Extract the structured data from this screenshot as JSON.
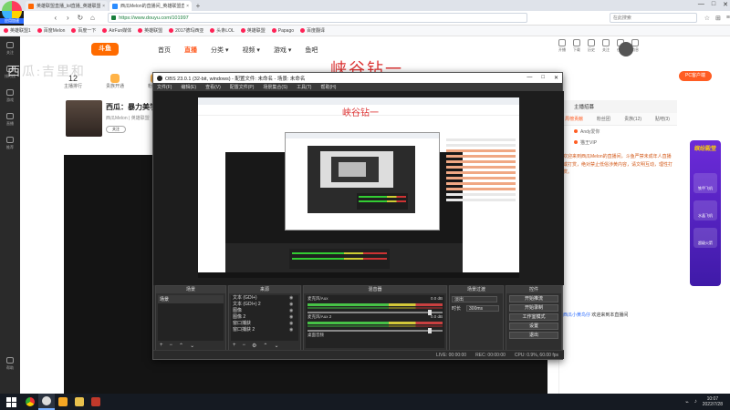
{
  "browser": {
    "corner_brand": "",
    "corner_badge": "应用加速",
    "tabs": [
      {
        "title": "英雄联盟直播_lol直播_英雄联盟...",
        "active": false
      },
      {
        "title": "西瓜Melon的直播间_英雄联盟直播...",
        "active": true
      }
    ],
    "new_tab": "+",
    "url": "https://www.douyu.com/101997",
    "search_placeholder": "在此搜索",
    "bookmarks": [
      "英雄联盟1",
      "百度Melon",
      "百度一下",
      "AirFun媒体",
      "英雄联盟",
      "2017德玛西亚",
      "头条LOL",
      "英雄联盟",
      "Papago",
      "百度翻译"
    ],
    "window_controls": [
      "—",
      "□",
      "✕"
    ]
  },
  "douyu": {
    "logo": "斗鱼",
    "nav": [
      {
        "label": "首页",
        "active": false
      },
      {
        "label": "直播",
        "active": true
      },
      {
        "label": "分类 ▾",
        "active": false
      },
      {
        "label": "视频 ▾",
        "active": false
      },
      {
        "label": "游戏 ▾",
        "active": false
      },
      {
        "label": "鱼吧",
        "active": false
      }
    ],
    "header_icons": [
      "开播",
      "下载",
      "历史",
      "关注",
      "任务",
      "消息"
    ],
    "pc_button": "PC客户端",
    "watermark_left": "西瓜:吉里和",
    "watermark_red": "峡谷钻一",
    "stats": [
      {
        "value": "12",
        "label": "主播排行"
      },
      {
        "value": "",
        "label": "贵族开通"
      },
      {
        "value": "",
        "label": "粉丝团"
      }
    ],
    "anchor": {
      "name": "西瓜：暴力美学",
      "meta": "西瓜Melon | 英雄联盟",
      "follow": "关注"
    },
    "rail": [
      "关注",
      "排行榜",
      "游戏",
      "直播",
      "推荐",
      "帮助"
    ],
    "right_panel": {
      "title": "主播招募",
      "tabs": [
        "周榜贡献",
        "粉丝团",
        "贵族(12)",
        "贴吧(3)"
      ],
      "rows": [
        "Andy爱你",
        "猫王VIP"
      ],
      "notice": "欢迎来到西瓜Melon的直播间，斗鱼严禁未成年人直播或打赏，绝对禁止低俗涉黄内容，请文明互动，理性打赏。",
      "chat_user": "西瓜小黄鸟仔",
      "chat_text": "欢迎来到本直播间"
    },
    "promo": {
      "title": "缤纷殿堂",
      "items": [
        "铁甲飞机",
        "水晶飞机",
        "超级火箭"
      ]
    }
  },
  "obs": {
    "title": "OBS 23.0.1 (32-bit, windows) - 配置文件: 未命名 - 场景: 未命名",
    "menu": [
      "文件(F)",
      "编辑(E)",
      "查看(V)",
      "配置文件(P)",
      "场景集合(S)",
      "工具(T)",
      "帮助(H)"
    ],
    "docks": {
      "scenes": {
        "title": "场景",
        "items": [
          "场景"
        ]
      },
      "sources": {
        "title": "来源",
        "items": [
          "文本 (GDI+)",
          "文本 (GDI+) 2",
          "图像",
          "图像 2",
          "窗口捕获",
          "窗口捕获 2"
        ]
      },
      "mixer": {
        "title": "混音器",
        "channels": [
          {
            "name": "麦克风/Aux",
            "db": "0.0 dB"
          },
          {
            "name": "麦克风/Aux 2",
            "db": "0.0 dB"
          },
          {
            "name": "桌面音频",
            "db": ""
          }
        ]
      },
      "transitions": {
        "title": "场景过渡",
        "type": "淡出",
        "duration_label": "时长",
        "duration": "300ms"
      },
      "controls": {
        "title": "控件",
        "buttons": [
          "开始推流",
          "开始录制",
          "工作室模式",
          "设置",
          "退出"
        ]
      }
    },
    "status": [
      "LIVE: 00:00:00",
      "REC: 00:00:00",
      "CPU: 0.9%, 60.00 fps"
    ],
    "foot_icons": [
      "+",
      "−",
      "⌃",
      "⌄"
    ]
  },
  "taskbar": {
    "apps": [
      "Chrome",
      "OBS",
      "浏览器",
      "文件夹",
      "媒体"
    ],
    "time": "10:07",
    "date": "2022/7/28"
  }
}
